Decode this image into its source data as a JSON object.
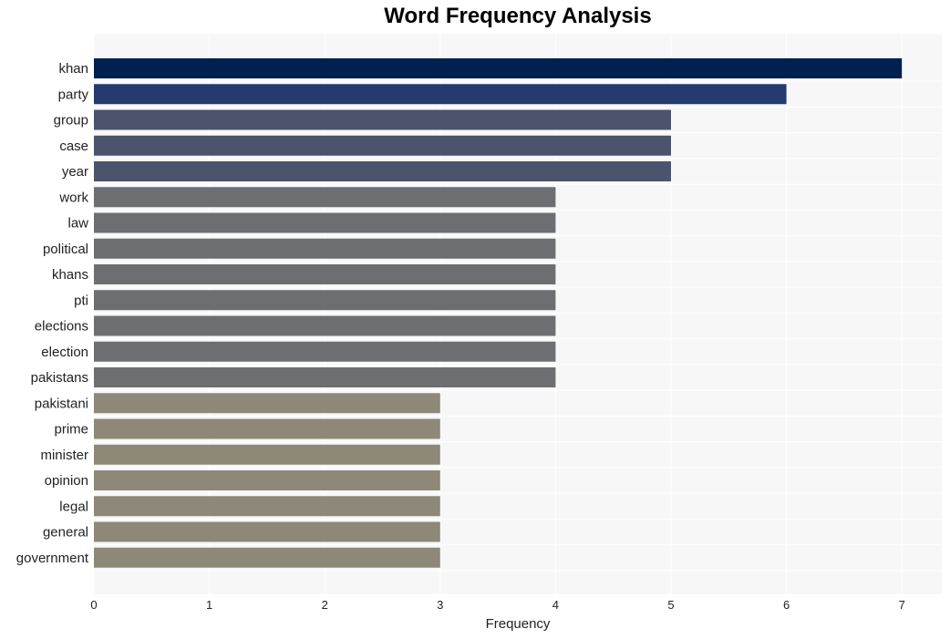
{
  "chart_data": {
    "type": "bar",
    "orientation": "horizontal",
    "title": "Word Frequency Analysis",
    "xlabel": "Frequency",
    "ylabel": "",
    "xlim": [
      0,
      7.35
    ],
    "xticks": [
      0,
      1,
      2,
      3,
      4,
      5,
      6,
      7
    ],
    "grid": true,
    "categories": [
      "khan",
      "party",
      "group",
      "case",
      "year",
      "work",
      "law",
      "political",
      "khans",
      "pti",
      "elections",
      "election",
      "pakistans",
      "pakistani",
      "prime",
      "minister",
      "opinion",
      "legal",
      "general",
      "government"
    ],
    "values": [
      7,
      6,
      5,
      5,
      5,
      4,
      4,
      4,
      4,
      4,
      4,
      4,
      4,
      3,
      3,
      3,
      3,
      3,
      3,
      3
    ],
    "colors_by_value": {
      "7": "#00204e",
      "6": "#233b6e",
      "5": "#4b546c",
      "4": "#6d6e72",
      "3": "#8e8879"
    },
    "plot_background": "#f7f7f7",
    "grid_color": "#ffffff"
  }
}
